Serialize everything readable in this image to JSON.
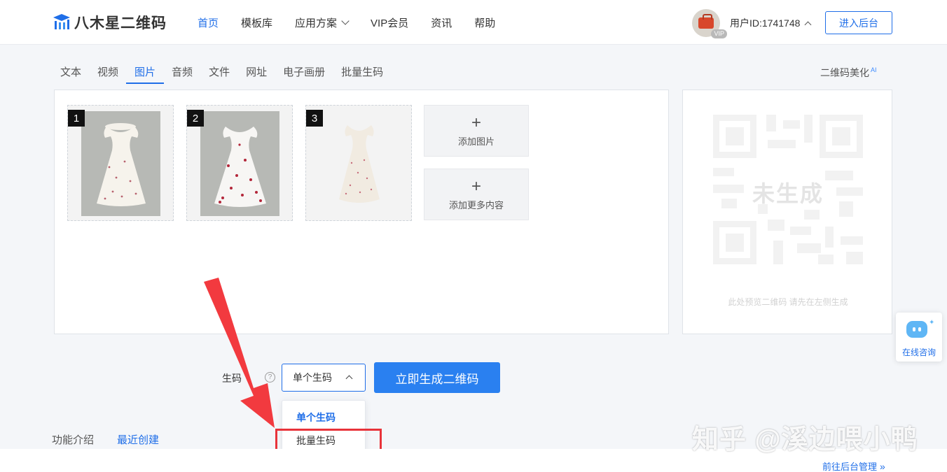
{
  "brand": {
    "name": "八木星二维码",
    "accent": "#1f6ee8"
  },
  "nav": [
    {
      "label": "首页",
      "active": true
    },
    {
      "label": "模板库"
    },
    {
      "label": "应用方案",
      "has_dropdown": true
    },
    {
      "label": "VIP会员"
    },
    {
      "label": "资讯"
    },
    {
      "label": "帮助"
    }
  ],
  "user": {
    "badge": "VIP",
    "id_text": "用户ID:1741748"
  },
  "header_button": "进入后台",
  "content_tabs": [
    {
      "label": "文本"
    },
    {
      "label": "视频"
    },
    {
      "label": "图片",
      "active": true
    },
    {
      "label": "音频"
    },
    {
      "label": "文件"
    },
    {
      "label": "网址"
    },
    {
      "label": "电子画册"
    },
    {
      "label": "批量生码"
    }
  ],
  "beautify": {
    "label": "二维码美化",
    "badge": "AI"
  },
  "images": [
    {
      "index": "1"
    },
    {
      "index": "2"
    },
    {
      "index": "3"
    }
  ],
  "add_image_label": "添加图片",
  "add_more_label": "添加更多内容",
  "preview": {
    "status": "未生成",
    "hint": "此处预览二维码 请先在左侧生成"
  },
  "generate": {
    "label": "生码",
    "help_icon": "?",
    "mode_selected": "单个生码",
    "options": [
      "单个生码",
      "批量生码"
    ],
    "button": "立即生成二维码"
  },
  "section_tabs": [
    {
      "label": "功能介绍"
    },
    {
      "label": "最近创建",
      "active": true
    }
  ],
  "backend_link": {
    "label": "前往后台管理",
    "icon": "»"
  },
  "consult": {
    "label": "在线咨询"
  },
  "watermark": "知乎 @溪边喂小鸭",
  "annotation_color": "#e8333a"
}
